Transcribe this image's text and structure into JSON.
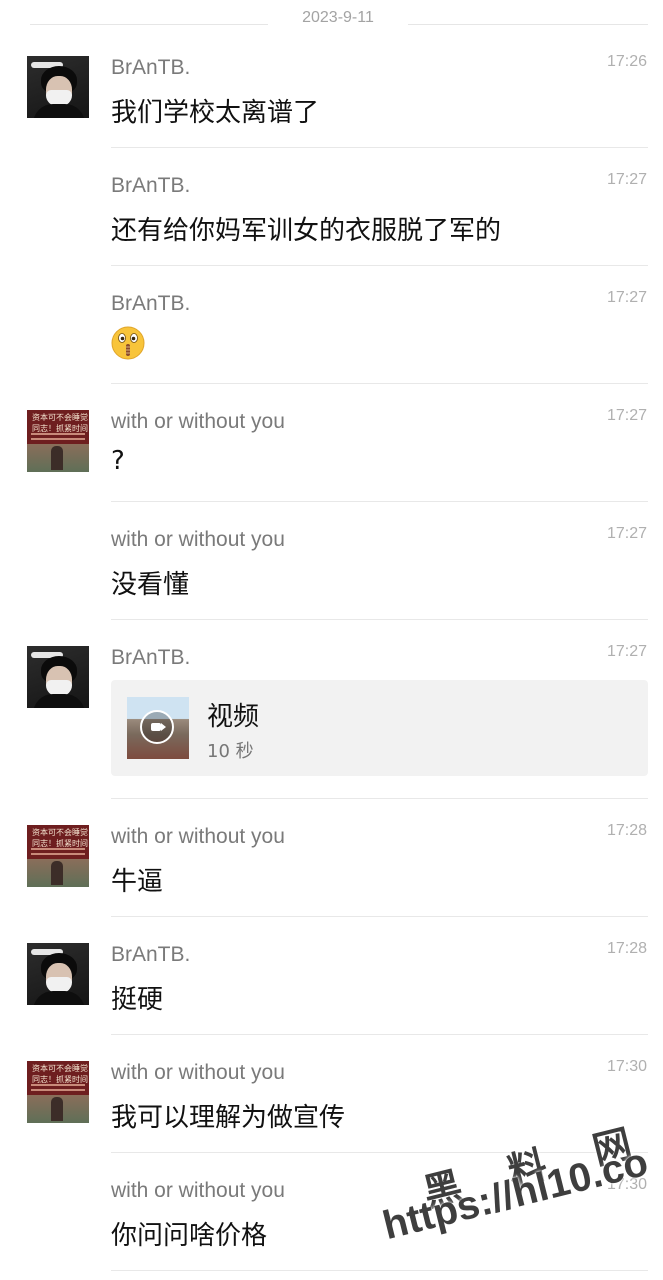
{
  "date_divider": "2023-9-11",
  "messages": [
    {
      "sender": "BrAnTB.",
      "time": "17:26",
      "text": "我们学校太离谱了"
    },
    {
      "sender": "BrAnTB.",
      "time": "17:27",
      "text": "还有给你妈军训女的衣服脱了军的"
    },
    {
      "sender": "BrAnTB.",
      "time": "17:27",
      "emoji": "zipper-mouth-face"
    },
    {
      "sender": "with or without you",
      "time": "17:27",
      "text": "?"
    },
    {
      "sender": "with or without you",
      "time": "17:27",
      "text": "没看懂"
    },
    {
      "sender": "BrAnTB.",
      "time": "17:27",
      "video": {
        "title": "视频",
        "duration": "10 秒"
      }
    },
    {
      "sender": "with or without you",
      "time": "17:28",
      "text": "牛逼"
    },
    {
      "sender": "BrAnTB.",
      "time": "17:28",
      "text": "挺硬"
    },
    {
      "sender": "with or without you",
      "time": "17:30",
      "text": "我可以理解为做宣传"
    },
    {
      "sender": "with or without you",
      "time": "17:30",
      "text": "你问问啥价格"
    }
  ],
  "avatar_text": {
    "wowy_line1": "资本可不会睡觉",
    "wowy_line2": "同志！抓紧时间",
    "brantb_banner": "全然 普雅 Miss"
  },
  "watermark": {
    "line1": "黑 料 网",
    "line2": "https://hl10.co"
  }
}
